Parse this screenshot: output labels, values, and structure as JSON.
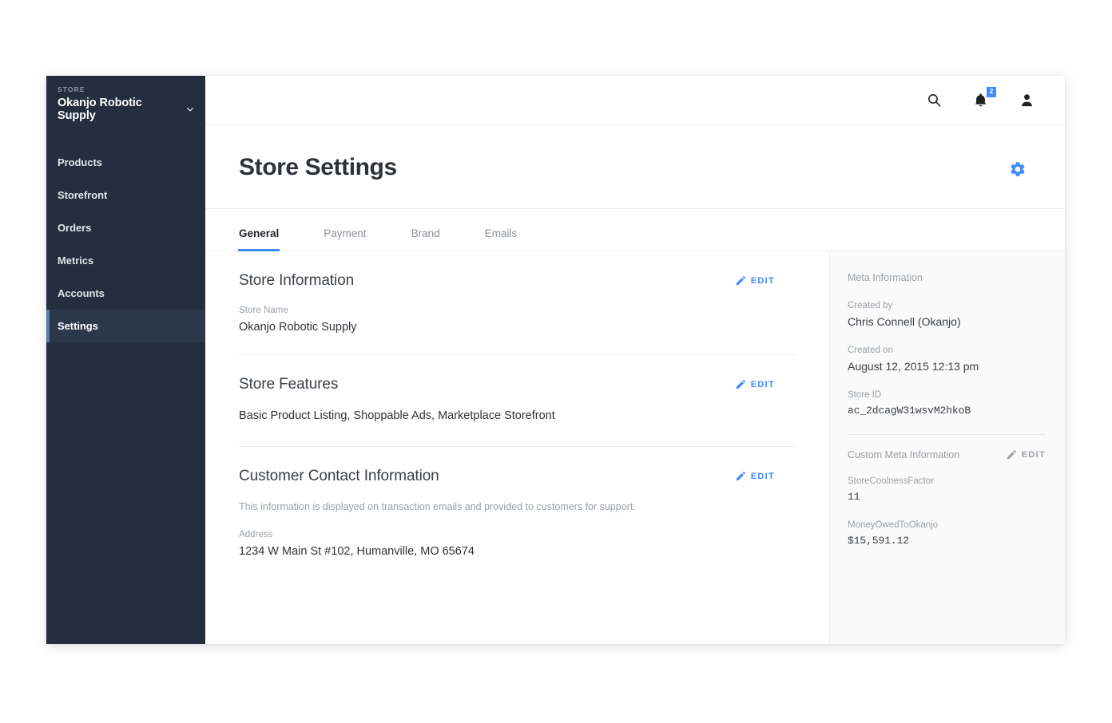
{
  "sidebar": {
    "kicker": "STORE",
    "store_name": "Okanjo Robotic Supply",
    "chevron_icon": "chevron-down-icon",
    "items": [
      {
        "label": "Products",
        "active": false
      },
      {
        "label": "Storefront",
        "active": false
      },
      {
        "label": "Orders",
        "active": false
      },
      {
        "label": "Metrics",
        "active": false
      },
      {
        "label": "Accounts",
        "active": false
      },
      {
        "label": "Settings",
        "active": true
      }
    ],
    "bg_color": "#232f3e",
    "active_bg_color": "#2b3849",
    "active_accent_color": "#5b7ca8"
  },
  "topbar": {
    "search_icon": "search-icon",
    "notifications_icon": "bell-icon",
    "notifications_count": "2",
    "badge_color": "#3d8bfd",
    "account_icon": "person-icon"
  },
  "header": {
    "title": "Store Settings",
    "settings_icon": "gear-icon",
    "settings_icon_color": "#3d8bfd"
  },
  "tabs": [
    {
      "label": "General",
      "active": true
    },
    {
      "label": "Payment",
      "active": false
    },
    {
      "label": "Brand",
      "active": false
    },
    {
      "label": "Emails",
      "active": false
    }
  ],
  "tab_accent_color": "#3d8bfd",
  "edit_label": "EDIT",
  "edit_icon": "pencil-icon",
  "sections": [
    {
      "title": "Store Information",
      "fields": [
        {
          "label": "Store Name",
          "value": "Okanjo Robotic Supply"
        }
      ]
    },
    {
      "title": "Store Features",
      "value": "Basic Product Listing, Shoppable Ads, Marketplace Storefront"
    },
    {
      "title": "Customer Contact Information",
      "description": "This information is displayed on transaction emails and provided to customers for support.",
      "fields": [
        {
          "label": "Address",
          "value": "1234  W Main St #102, Humanville, MO 65674"
        }
      ]
    }
  ],
  "meta": {
    "heading": "Meta Information",
    "blocks": [
      {
        "label": "Created by",
        "value": "Chris Connell (Okanjo)",
        "mono": false
      },
      {
        "label": "Created on",
        "value": "August 12, 2015 12:13 pm",
        "mono": false
      },
      {
        "label": "Store ID",
        "value": "ac_2dcagW31wsvM2hkoB",
        "mono": true
      }
    ],
    "custom_heading": "Custom Meta Information",
    "custom_edit_label": "EDIT",
    "custom_blocks": [
      {
        "label": "StoreCoolnessFactor",
        "value": "11",
        "mono": true
      },
      {
        "label": "MoneyOwedToOkanjo",
        "value": "$15,591.12",
        "mono": true
      }
    ]
  }
}
